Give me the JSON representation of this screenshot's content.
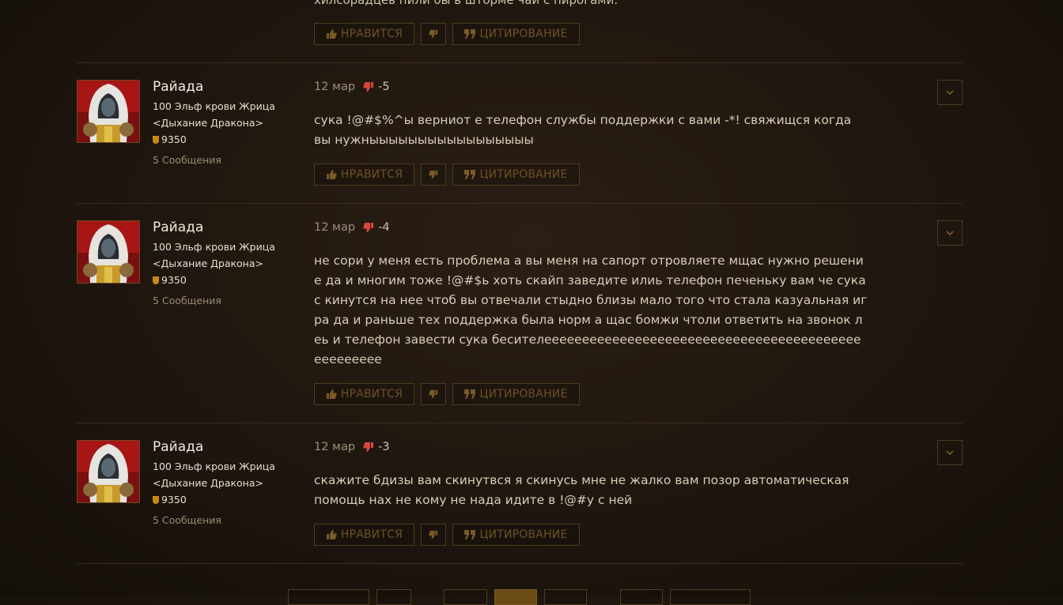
{
  "top_fragment": "хилсорадцев пили бы в шторме чай с пирогами.",
  "buttons": {
    "like": "НРАВИТСЯ",
    "quote": "ЦИТИРОВАНИЕ"
  },
  "posts": [
    {
      "author": "Райада",
      "level_class": "100 Эльф крови Жрица",
      "guild": "<Дыхание Дракона>",
      "achievement_points": "9350",
      "post_count": "5 Сообщения",
      "date": "12 мар",
      "score": "-5",
      "text": "сука !@#$%^ы верниот е телефон службы поддержки с вами -*! свяжищся когда вы нужныыыыыыыыыыыыыыыыы"
    },
    {
      "author": "Райада",
      "level_class": "100 Эльф крови Жрица",
      "guild": "<Дыхание Дракона>",
      "achievement_points": "9350",
      "post_count": "5 Сообщения",
      "date": "12 мар",
      "score": "-4",
      "text": "не сори у меня есть проблема а вы меня на сапорт отровляете мщас нужно решение да и многим тоже !@#$ь хоть скайп заведите илиь телефон печеньку вам че сука с кинутся на нее чтоб вы отвечали стыдно близы мало того что стала казуальная игра да и раньше тех поддержка была норм а щас бомжи чтоли ответить на звонок леь и телефон завести сука бесителеееееееееееееееееееееееееееееееееееееееееееееееееее"
    },
    {
      "author": "Райада",
      "level_class": "100 Эльф крови Жрица",
      "guild": "<Дыхание Дракона>",
      "achievement_points": "9350",
      "post_count": "5 Сообщения",
      "date": "12 мар",
      "score": "-3",
      "text": "скажите бдизы вам скинутвся я скинусь мне не жалко вам позор автоматическая помощь нах не кому не нада идите в !@#у с ней"
    }
  ],
  "colors": {
    "accent": "#6e5224",
    "dislike": "#d9473a",
    "background": "#1d150e"
  },
  "icons": {
    "like": "thumbs-up-icon",
    "dislike": "thumbs-down-icon",
    "quote": "quote-icon",
    "dropdown": "chevron-down-icon"
  }
}
